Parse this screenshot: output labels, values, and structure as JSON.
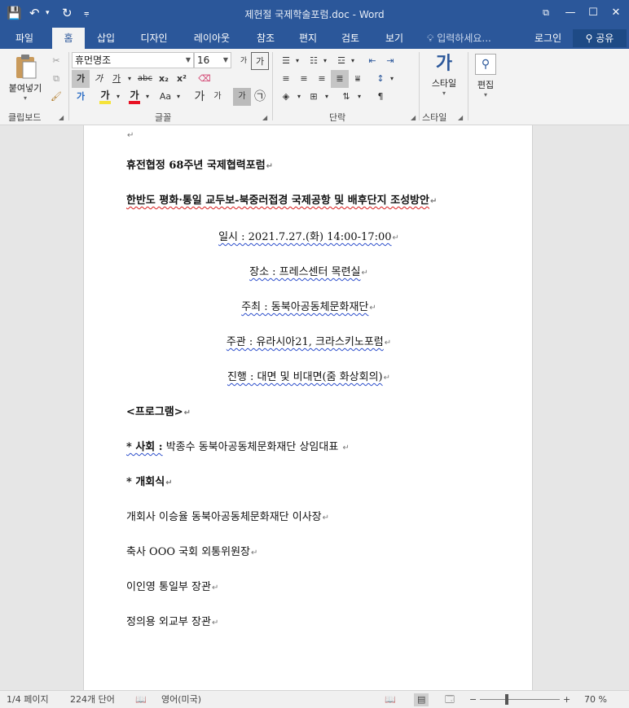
{
  "window": {
    "title": "제헌절 국제학술포럼.doc - Word",
    "save_icon": "💾",
    "undo_icon": "↶",
    "undo_dropdown": "▾",
    "redo_icon": "↻",
    "customize_icon": "⩦",
    "restore_icon": "⧉",
    "minimize_icon": "—",
    "maximize_icon": "☐",
    "close_icon": "✕"
  },
  "tabs": [
    {
      "label": "파일"
    },
    {
      "label": "홈"
    },
    {
      "label": "삽입"
    },
    {
      "label": "디자인"
    },
    {
      "label": "레이아웃"
    },
    {
      "label": "참조"
    },
    {
      "label": "편지"
    },
    {
      "label": "검토"
    },
    {
      "label": "보기"
    }
  ],
  "tell_me": "입력하세요...",
  "login": "로그인",
  "share": "공유",
  "ribbon": {
    "clipboard": {
      "paste_label": "붙여넣기",
      "group_label": "클립보드"
    },
    "font": {
      "family": "휴먼명조",
      "size": "16",
      "bold": "가",
      "italic": "가",
      "underline": "가",
      "strike": "abc",
      "subscript": "x₂",
      "superscript": "x²",
      "font_color": "가",
      "highlight": "가",
      "text_effect": "가",
      "case": "Aa",
      "phonetic": "가",
      "char_border": "가",
      "enclose": "㉠",
      "grow": "가",
      "shrink": "가",
      "group_label": "글꼴",
      "highlight_color": "#f5e33a",
      "font_color_value": "#e81123"
    },
    "paragraph": {
      "group_label": "단락"
    },
    "styles": {
      "style_label": "스타일",
      "group_label": "스타일",
      "styles_glyph": "가"
    },
    "editing": {
      "label": "편집"
    }
  },
  "document": {
    "lines": [
      {
        "text": "",
        "mark": "↵"
      },
      {
        "text": "휴전협정 68주년 국제협력포럼",
        "mark": "↵"
      },
      {
        "text": "한반도 평화·통일 교두보-북중러접경 국제공항 및 배후단지 조성방안",
        "mark": "↵"
      },
      {
        "text": "일시 : 2021.7.27.(화) 14:00-17:00",
        "mark": "↵"
      },
      {
        "text": "장소 : 프레스센터 목련실",
        "mark": "↵"
      },
      {
        "text": "주최 : 동북아공동체문화재단",
        "mark": "↵"
      },
      {
        "text": "주관 : 유라시아21, 크라스키노포럼",
        "mark": "↵"
      },
      {
        "text": "진행 : 대면 및 비대면(줌 화상회의)",
        "mark": "↵"
      },
      {
        "text": "<프로그램>",
        "mark": "↵"
      },
      {
        "bullet": "* 사회 :",
        "text": " 박종수 동북아공동체문화재단 상임대표 ",
        "mark": "↵"
      },
      {
        "text": "* 개회식",
        "mark": "↵"
      },
      {
        "text": "개회사 이승율 동북아공동체문화재단 이사장",
        "mark": "↵"
      },
      {
        "text": "축사 OOO 국회 외통위원장",
        "mark": "↵"
      },
      {
        "text": "이인영 통일부 장관",
        "mark": "↵"
      },
      {
        "text": "정의용 외교부 장관",
        "mark": "↵"
      }
    ]
  },
  "status": {
    "page": "1/4 페이지",
    "words": "224개 단어",
    "proof_icon": "📖",
    "language": "영어(미국)",
    "read_mode_icon": "📖",
    "print_layout_icon": "▤",
    "web_layout_icon": "🗔",
    "zoom_out": "−",
    "zoom_in": "+",
    "zoom": "70 %",
    "zoom_fraction": 0.34
  }
}
